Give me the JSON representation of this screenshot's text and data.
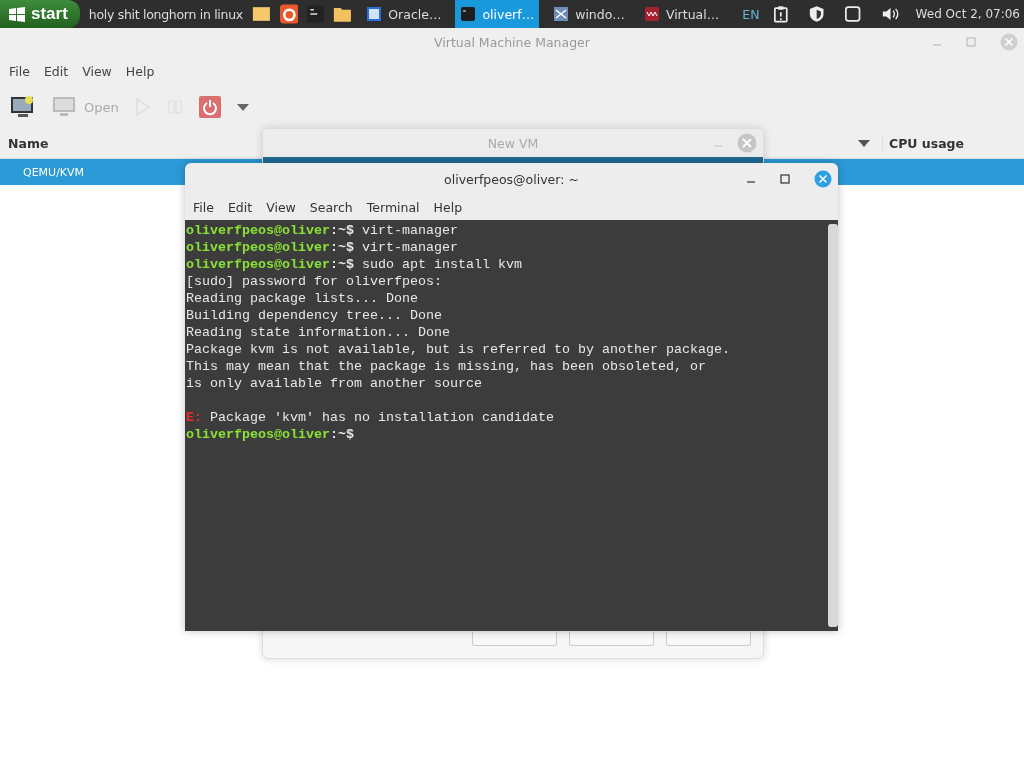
{
  "taskbar": {
    "start_label": "start",
    "title_text": "holy shit longhorn in linux",
    "tasks": [
      {
        "label": "Oracle…",
        "kind": "vbox",
        "selected": false
      },
      {
        "label": "oliverf…",
        "kind": "terminal",
        "selected": true
      },
      {
        "label": "windo…",
        "kind": "windows",
        "selected": false
      },
      {
        "label": "Virtual…",
        "kind": "vmm",
        "selected": false
      }
    ],
    "keyboard_layout": "EN",
    "clock": "Wed Oct  2, 07:06"
  },
  "vmm_window": {
    "title": "Virtual Machine Manager",
    "menu": [
      "File",
      "Edit",
      "View",
      "Help"
    ],
    "toolbar": {
      "open_label": "Open"
    },
    "columns": [
      "Name",
      "CPU usage"
    ],
    "rows": [
      {
        "name": "QEMU/KVM",
        "selected": true
      }
    ]
  },
  "new_vm_dialog": {
    "title": "New VM"
  },
  "terminal": {
    "title": "oliverfpeos@oliver: ~",
    "menu": [
      "File",
      "Edit",
      "View",
      "Search",
      "Terminal",
      "Help"
    ],
    "lines": [
      {
        "kind": "prompt",
        "user": "oliverfpeos@oliver",
        "path": ":~$",
        "command": "virt-manager"
      },
      {
        "kind": "prompt",
        "user": "oliverfpeos@oliver",
        "path": ":~$",
        "command": "virt-manager"
      },
      {
        "kind": "prompt",
        "user": "oliverfpeos@oliver",
        "path": ":~$",
        "command": "sudo apt install kvm"
      },
      {
        "kind": "output",
        "text": "[sudo] password for oliverfpeos:"
      },
      {
        "kind": "output",
        "text": "Reading package lists... Done"
      },
      {
        "kind": "output",
        "text": "Building dependency tree... Done"
      },
      {
        "kind": "output",
        "text": "Reading state information... Done"
      },
      {
        "kind": "output",
        "text": "Package kvm is not available, but is referred to by another package."
      },
      {
        "kind": "output",
        "text": "This may mean that the package is missing, has been obsoleted, or"
      },
      {
        "kind": "output",
        "text": "is only available from another source"
      },
      {
        "kind": "blank"
      },
      {
        "kind": "error",
        "prefix": "E:",
        "text": "Package 'kvm' has no installation candidate"
      },
      {
        "kind": "prompt",
        "user": "oliverfpeos@oliver",
        "path": ":~$"
      }
    ]
  }
}
